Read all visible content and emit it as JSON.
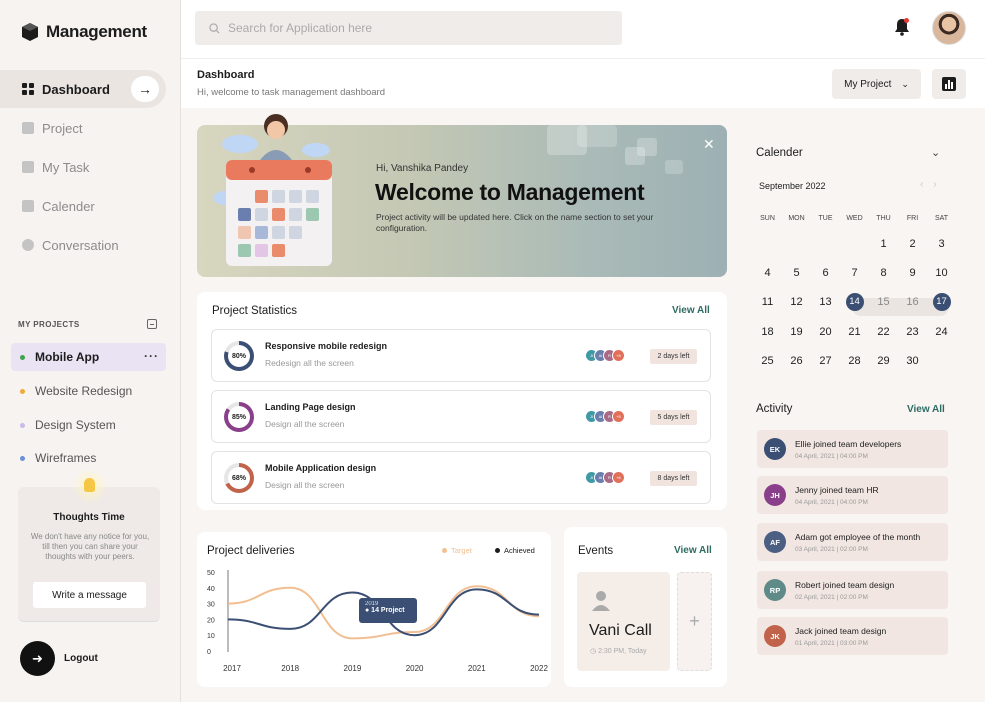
{
  "app": {
    "name": "Management"
  },
  "nav": [
    {
      "label": "Dashboard",
      "icon": "grid-icon",
      "active": true
    },
    {
      "label": "Project",
      "icon": "edit-icon"
    },
    {
      "label": "My Task",
      "icon": "bar-icon"
    },
    {
      "label": "Calender",
      "icon": "calendar-icon"
    },
    {
      "label": "Conversation",
      "icon": "chat-icon"
    }
  ],
  "my_projects": {
    "title": "MY PROJECTS",
    "items": [
      {
        "label": "Mobile App",
        "color": "#3fa34d",
        "active": true
      },
      {
        "label": "Website Redesign",
        "color": "#f2a93b"
      },
      {
        "label": "Design System",
        "color": "#cbb9e8"
      },
      {
        "label": "Wireframes",
        "color": "#6c8fd6"
      }
    ],
    "more_label": "···"
  },
  "thoughts": {
    "title": "Thoughts Time",
    "text": "We don't have any notice for you, till then you can share your thoughts with your peers.",
    "button": "Write a message"
  },
  "logout": {
    "label": "Logout"
  },
  "search": {
    "placeholder": "Search for Application here"
  },
  "header": {
    "title": "Dashboard",
    "subtitle": "Hi, welcome to task management dashboard",
    "project_select": "My Project"
  },
  "banner": {
    "greeting": "Hi, Vanshika Pandey",
    "title": "Welcome to Management",
    "text": "Project activity will be updated here. Click on the name section to set your configuration."
  },
  "project_stats": {
    "title": "Project Statistics",
    "view_all": "View All",
    "rows": [
      {
        "percent": "80%",
        "value": 80,
        "color": "#3a4f73",
        "name": "Responsive mobile redesign",
        "sub": "Redesign all the screen",
        "more": "+8",
        "days": "2 days left"
      },
      {
        "percent": "85%",
        "value": 85,
        "color": "#8a3f8a",
        "name": "Landing Page design",
        "sub": "Design all the screen",
        "more": "+5",
        "days": "5 days left"
      },
      {
        "percent": "68%",
        "value": 68,
        "color": "#c0634a",
        "name": "Mobile Application design",
        "sub": "Design all the screen",
        "more": "+6",
        "days": "8 days left"
      }
    ],
    "avatars": [
      "JI",
      "AI",
      "R"
    ]
  },
  "deliveries": {
    "title": "Project deliveries",
    "legend_target": "Target",
    "legend_achieved": "Achieved",
    "tooltip_year": "2019",
    "tooltip_value": "● 14 Project"
  },
  "chart_data": {
    "type": "line",
    "x": [
      "2017",
      "2018",
      "2019",
      "2020",
      "2021",
      "2022"
    ],
    "ylim": [
      0,
      50
    ],
    "yticks": [
      "50",
      "40",
      "30",
      "20",
      "10",
      "0"
    ],
    "series": [
      {
        "name": "Target",
        "color": "#f2bf93",
        "values": [
          30,
          40,
          8,
          12,
          41,
          22
        ]
      },
      {
        "name": "Achieved",
        "color": "#3a4f73",
        "values": [
          20,
          14,
          37,
          10,
          39,
          23
        ]
      }
    ],
    "annotation": {
      "x": "2019",
      "label": "14 Project"
    }
  },
  "events": {
    "title": "Events",
    "view_all": "View All",
    "name": "Vani Call",
    "time": "2:30 PM, Today",
    "add_label": "+"
  },
  "calendar": {
    "title": "Calender",
    "month": "September 2022",
    "days": [
      "SUN",
      "MON",
      "TUE",
      "WED",
      "THU",
      "FRI",
      "SAT"
    ],
    "weeks": [
      [
        "",
        "",
        "",
        "",
        "1",
        "2",
        "3"
      ],
      [
        "4",
        "5",
        "6",
        "7",
        "8",
        "9",
        "10"
      ],
      [
        "11",
        "12",
        "13",
        "14",
        "15",
        "16",
        "17"
      ],
      [
        "18",
        "19",
        "20",
        "21",
        "22",
        "23",
        "24"
      ],
      [
        "25",
        "26",
        "27",
        "28",
        "29",
        "30",
        ""
      ]
    ],
    "range_start": "14",
    "range_end": "17"
  },
  "activity": {
    "title": "Activity",
    "view_all": "View All",
    "items": [
      {
        "initials": "EK",
        "color": "#3a4f73",
        "text": "Ellie joined team developers",
        "date": "04 April, 2021 | 04:00 PM"
      },
      {
        "initials": "JH",
        "color": "#8a3f8a",
        "text": "Jenny joined team HR",
        "date": "04 April, 2021 | 04:00 PM"
      },
      {
        "initials": "AF",
        "color": "#4a5f82",
        "text": "Adam got employee of the month",
        "date": "03 April, 2021 | 02:00 PM"
      },
      {
        "initials": "RP",
        "color": "#5e8a88",
        "text": "Robert joined team design",
        "date": "02 April, 2021 | 02:00 PM"
      },
      {
        "initials": "JK",
        "color": "#c0634a",
        "text": "Jack joined team design",
        "date": "01 April, 2021 | 03:00 PM"
      }
    ]
  }
}
